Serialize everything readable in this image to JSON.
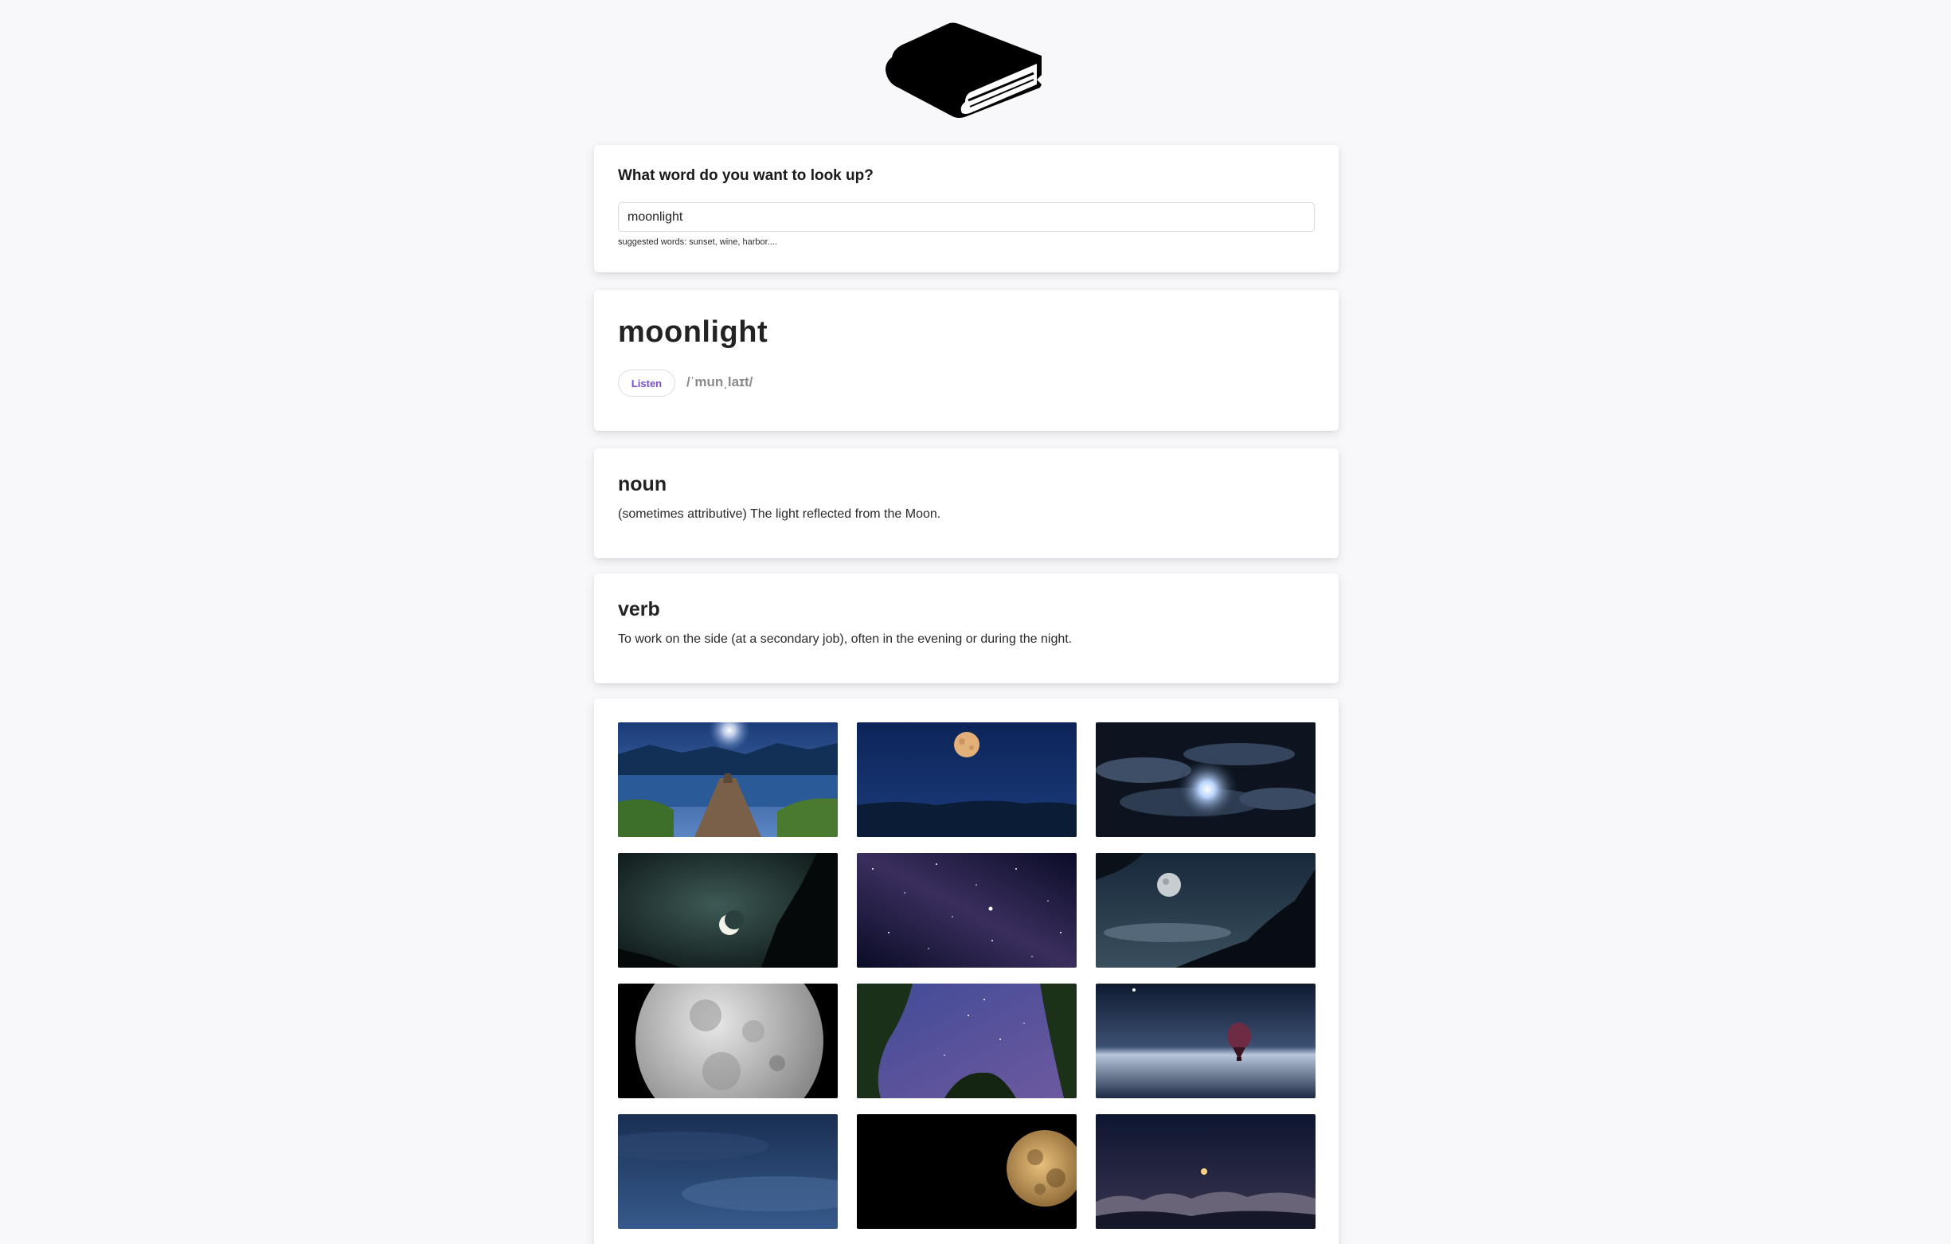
{
  "logo": {
    "icon": "book-icon"
  },
  "search": {
    "question": "What word do you want to look up?",
    "value": "moonlight",
    "hint": "suggested words: sunset, wine, harbor...."
  },
  "word": {
    "title": "moonlight",
    "listen_label": "Listen",
    "phonetic": "/ˈmunˌlaɪt/"
  },
  "meanings": [
    {
      "part_of_speech": "noun",
      "definition": "(sometimes attributive) The light reflected from the Moon."
    },
    {
      "part_of_speech": "verb",
      "definition": "To work on the side (at a secondary job), often in the evening or during the night."
    }
  ],
  "gallery": {
    "images": [
      "lake-pier-moonrise-photo",
      "full-moon-night-sky-photo",
      "moon-behind-clouds-photo",
      "crescent-moon-cliff-photo",
      "milky-way-stars-photo",
      "moon-over-palm-trees-photo",
      "full-moon-closeup-photo",
      "starry-sky-through-trees-photo",
      "hot-air-balloon-night-photo",
      "dark-blue-clouds-photo",
      "golden-full-moon-photo",
      "moon-over-clouds-photo"
    ]
  }
}
